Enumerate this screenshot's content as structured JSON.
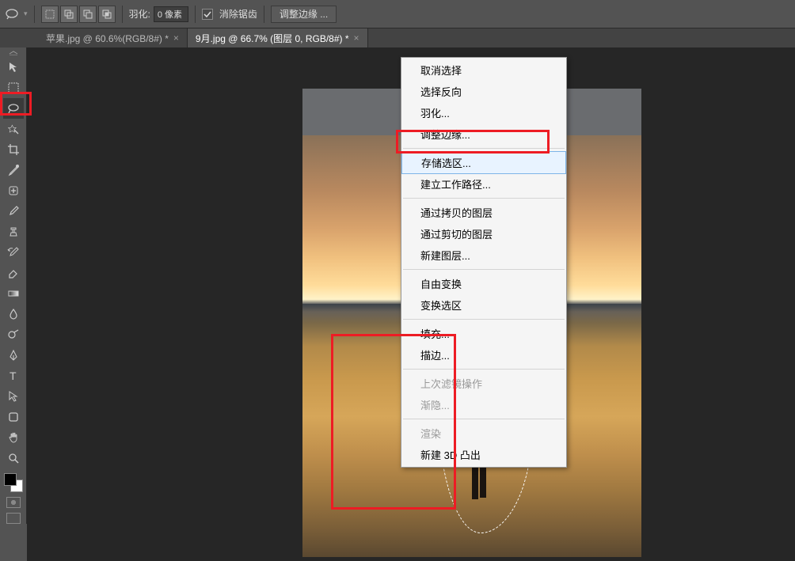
{
  "options_bar": {
    "feather_label": "羽化:",
    "feather_value": "0 像素",
    "antialias_label": "消除锯齿",
    "refine_edge_label": "调整边缘 ..."
  },
  "tabs": [
    {
      "label": "苹果.jpg @ 60.6%(RGB/8#) *",
      "active": false
    },
    {
      "label": "9月.jpg @ 66.7% (图层 0, RGB/8#) *",
      "active": true
    }
  ],
  "tools": [
    {
      "name": "move-tool"
    },
    {
      "name": "marquee-tool"
    },
    {
      "name": "lasso-tool",
      "selected": true
    },
    {
      "name": "magic-wand-tool"
    },
    {
      "name": "crop-tool"
    },
    {
      "name": "eyedropper-tool"
    },
    {
      "name": "healing-brush-tool"
    },
    {
      "name": "brush-tool"
    },
    {
      "name": "clone-stamp-tool"
    },
    {
      "name": "history-brush-tool"
    },
    {
      "name": "eraser-tool"
    },
    {
      "name": "gradient-tool"
    },
    {
      "name": "blur-tool"
    },
    {
      "name": "dodge-tool"
    },
    {
      "name": "pen-tool"
    },
    {
      "name": "type-tool"
    },
    {
      "name": "path-selection-tool"
    },
    {
      "name": "shape-tool"
    },
    {
      "name": "hand-tool"
    },
    {
      "name": "zoom-tool"
    }
  ],
  "context_menu": {
    "items": [
      {
        "label": "取消选择"
      },
      {
        "label": "选择反向"
      },
      {
        "label": "羽化..."
      },
      {
        "label": "调整边缘..."
      },
      {
        "sep": true
      },
      {
        "label": "存储选区...",
        "highlighted": true
      },
      {
        "label": "建立工作路径..."
      },
      {
        "sep": true
      },
      {
        "label": "通过拷贝的图层"
      },
      {
        "label": "通过剪切的图层"
      },
      {
        "label": "新建图层..."
      },
      {
        "sep": true
      },
      {
        "label": "自由变换"
      },
      {
        "label": "变换选区"
      },
      {
        "sep": true
      },
      {
        "label": "填充..."
      },
      {
        "label": "描边..."
      },
      {
        "sep": true
      },
      {
        "label": "上次滤镜操作",
        "disabled": true
      },
      {
        "label": "渐隐...",
        "disabled": true
      },
      {
        "sep": true
      },
      {
        "label": "渲染",
        "disabled": true
      },
      {
        "label": "新建 3D 凸出"
      }
    ]
  }
}
